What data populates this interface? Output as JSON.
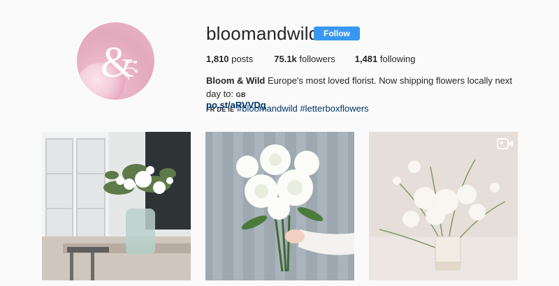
{
  "profile": {
    "username": "bloomandwild",
    "follow_label": "Follow",
    "avatar": "bloom-and-wild-logo"
  },
  "stats": {
    "posts_count": "1,810",
    "posts_label": "posts",
    "followers_count": "75.1k",
    "followers_label": "followers",
    "following_count": "1,481",
    "following_label": "following"
  },
  "bio": {
    "name": "Bloom & Wild",
    "text": "Europe's most loved florist. Now shipping flowers locally next day to:",
    "country_line1": "GB",
    "country_line2": "FR DE IE",
    "hashtag1": "#bloomandwild",
    "hashtag2": "#letterboxflowers",
    "link": "po.st/aRVVDg"
  },
  "posts": [
    {
      "description": "white flowers in glass jar vase on dining table"
    },
    {
      "description": "hand holding white peony bouquet"
    },
    {
      "description": "white flowers in ceramic vase",
      "icon": "video-icon"
    }
  ],
  "colors": {
    "follow_button": "#3897f0",
    "link_text": "#003569",
    "background": "#fafafa"
  }
}
